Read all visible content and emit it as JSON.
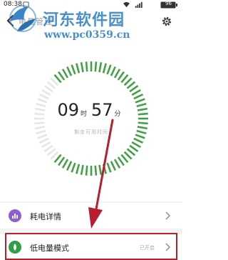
{
  "status_bar": {
    "time": "08:38",
    "battery": "96"
  },
  "header": {
    "title": "电量管理"
  },
  "watermark": {
    "site_name": "河东软件园",
    "url": "www.pc0359.cn"
  },
  "battery_estimate": {
    "hours": "09",
    "hours_unit": "时",
    "minutes": "57",
    "minutes_unit": "分",
    "caption": "剩余可用时间"
  },
  "menu": {
    "items": [
      {
        "label": "耗电详情",
        "icon": "bar-chart-icon",
        "status": ""
      },
      {
        "label": "低电量模式",
        "icon": "leaf-icon",
        "status": "已开启"
      }
    ]
  },
  "colors": {
    "gauge_active": "#43a047",
    "gauge_inactive": "#e6e6e6",
    "annotation": "#b81f2c",
    "icon_purple": "#8e5fd1",
    "icon_green": "#2e9e48",
    "watermark": "#3a86c8"
  }
}
